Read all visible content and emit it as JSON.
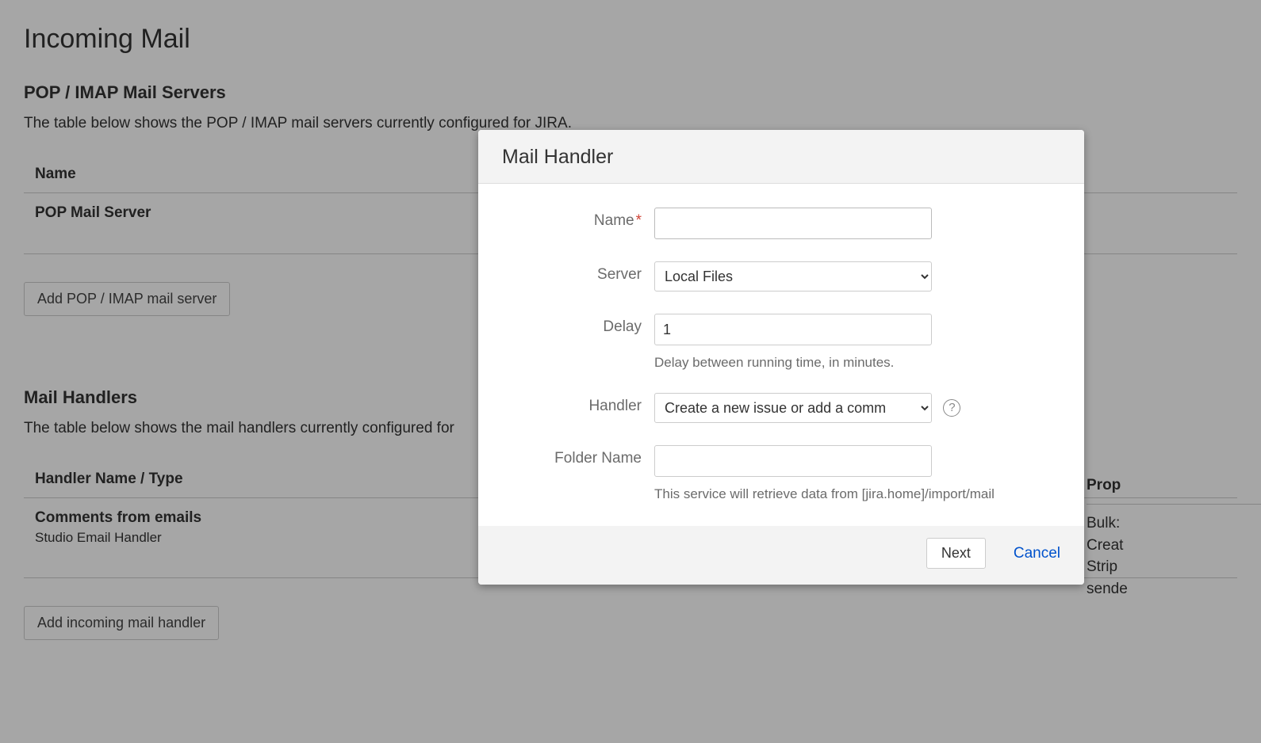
{
  "page": {
    "title": "Incoming Mail",
    "servers_section": {
      "heading": "POP / IMAP Mail Servers",
      "description": "The table below shows the POP / IMAP mail servers currently configured for JIRA.",
      "columns": {
        "name": "Name"
      },
      "rows": [
        {
          "name": "POP Mail Server"
        }
      ],
      "add_button": "Add POP / IMAP mail server"
    },
    "handlers_section": {
      "heading": "Mail Handlers",
      "description": "The table below shows the mail handlers currently configured for",
      "columns": {
        "name": "Handler Name / Type",
        "props": "Prop"
      },
      "rows": [
        {
          "name": "Comments from emails",
          "subtype": "Studio Email Handler",
          "props_lines": [
            "Bulk:",
            "Creat",
            "Strip",
            "sende"
          ]
        }
      ],
      "add_button": "Add incoming mail handler"
    }
  },
  "modal": {
    "title": "Mail Handler",
    "fields": {
      "name": {
        "label": "Name",
        "required": true,
        "value": ""
      },
      "server": {
        "label": "Server",
        "value": "Local Files",
        "options": [
          "Local Files"
        ]
      },
      "delay": {
        "label": "Delay",
        "value": "1",
        "help": "Delay between running time, in minutes."
      },
      "handler": {
        "label": "Handler",
        "value": "Create a new issue or add a comm",
        "options": [
          "Create a new issue or add a comm"
        ]
      },
      "folder": {
        "label": "Folder Name",
        "value": "",
        "help": "This service will retrieve data from [jira.home]/import/mail"
      }
    },
    "buttons": {
      "next": "Next",
      "cancel": "Cancel"
    }
  }
}
